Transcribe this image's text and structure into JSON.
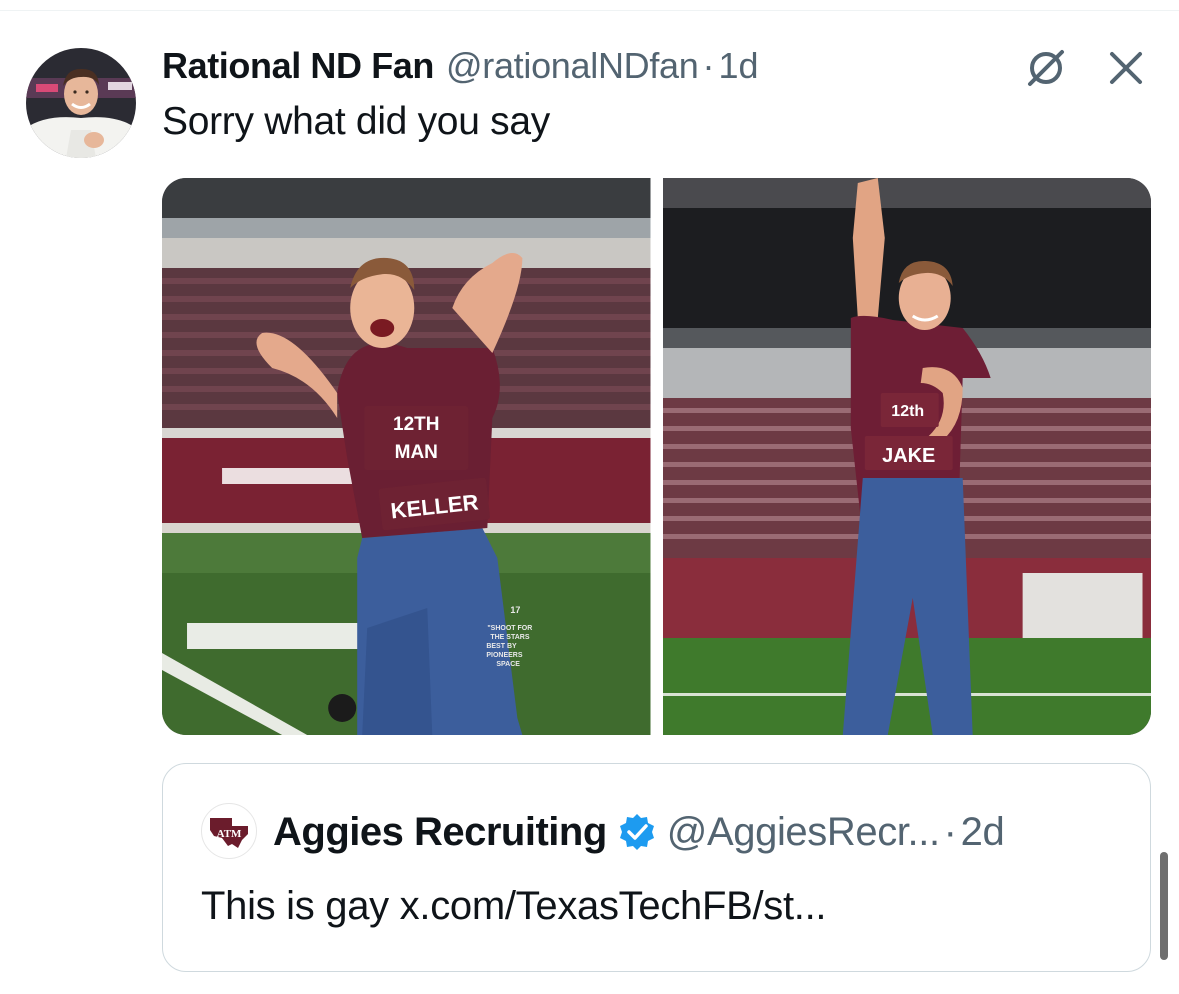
{
  "post": {
    "author": {
      "display_name": "Rational ND Fan",
      "handle": "@rationalNDfan",
      "separator": "·",
      "time": "1d",
      "avatar_icon": "profile-photo"
    },
    "text": "Sorry what did you say",
    "header_icons": [
      "grok-icon",
      "close-icon"
    ],
    "media": [
      {
        "description_icon": "photo",
        "overall_label_line1": "12TH",
        "overall_label_line2": "MAN",
        "name_patch": "KELLER",
        "small_print_1": "17",
        "small_print_2": "\"SHOOT FOR",
        "small_print_3": "THE STARS",
        "small_print_4": "BEST BY",
        "small_print_5": "PIONEERS",
        "small_print_6": "SPACE"
      },
      {
        "description_icon": "photo",
        "overall_label_line1": "12th",
        "name_patch": "JAKE"
      }
    ]
  },
  "quote": {
    "display_name": "Aggies Recruiting",
    "verified_icon": "verified-badge-icon",
    "handle": "@AggiesRecr...",
    "separator": "·",
    "time": "2d",
    "logo_text": "ATM",
    "text": "This is gay x.com/TexasTechFB/st..."
  },
  "colors": {
    "text_primary": "#0f1419",
    "text_secondary": "#536471",
    "border": "#cfd9de",
    "verified": "#1d9bf0",
    "maroon": "#6b1c2c"
  }
}
